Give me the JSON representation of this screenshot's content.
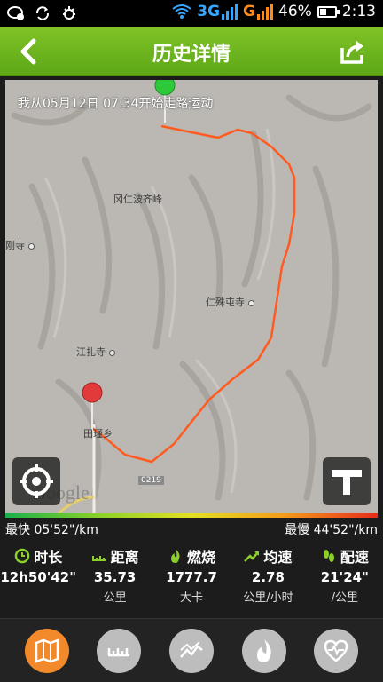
{
  "status_bar": {
    "network_3g": "3G",
    "network_g": "G",
    "battery": "46%",
    "battery_level": 0.46,
    "time": "2:13"
  },
  "header": {
    "title": "历史详情"
  },
  "map": {
    "start_text": "我从05月12日 07:34开始走路运动",
    "pois": [
      "冈仁波齐峰",
      "刚寺",
      "仁殊屯寺",
      "江扎寺",
      "田瑾乡"
    ],
    "road_tag": "0219",
    "watermark": "Google"
  },
  "speed": {
    "fastest": "最快 05'52\"/km",
    "slowest": "最慢 44'52\"/km"
  },
  "stats": [
    {
      "label": "时长",
      "value": "12h50'42\"",
      "unit": ""
    },
    {
      "label": "距离",
      "value": "35.73",
      "unit": "公里"
    },
    {
      "label": "燃烧",
      "value": "1777.7",
      "unit": "大卡"
    },
    {
      "label": "均速",
      "value": "2.78",
      "unit": "公里/小时"
    },
    {
      "label": "配速",
      "value": "21'24\"",
      "unit": "/公里"
    }
  ],
  "colors": {
    "header_green": "#6cb51f",
    "route_red": "#ff5a1f",
    "accent_green": "#8bd12a",
    "active_orange": "#f28a2b"
  },
  "nav_icons": [
    "map-icon",
    "ruler-icon",
    "chart-icon",
    "flame-icon",
    "heart-icon"
  ]
}
